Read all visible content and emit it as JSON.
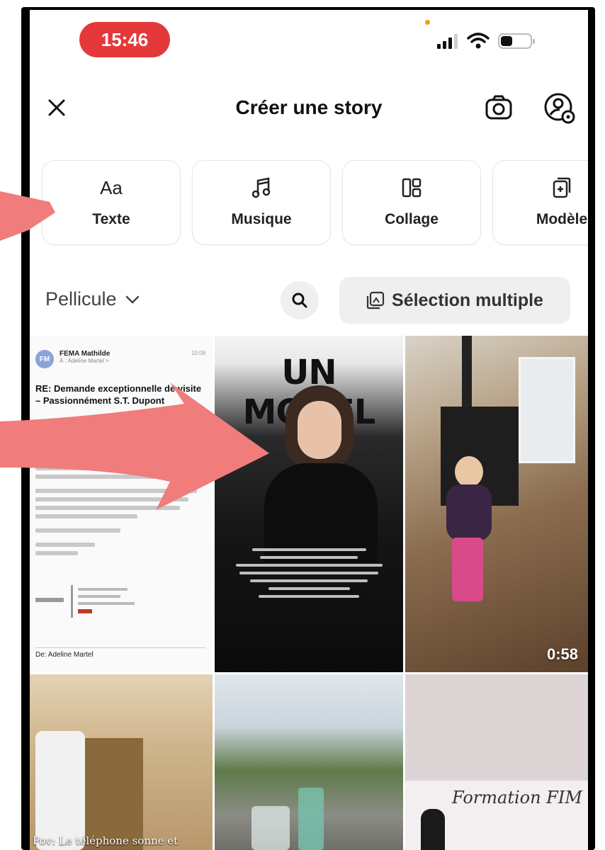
{
  "status": {
    "time": "15:46"
  },
  "header": {
    "title": "Créer une story"
  },
  "options": [
    {
      "label": "Texte",
      "icon": "Aa"
    },
    {
      "label": "Musique"
    },
    {
      "label": "Collage"
    },
    {
      "label": "Modèle"
    }
  ],
  "gallery": {
    "album": "Pellicule",
    "multi_select": "Sélection multiple"
  },
  "tiles": {
    "email": {
      "avatar": "FM",
      "sender": "FEMA Mathilde",
      "to": "À : Adeline Martel >",
      "time": "10:08",
      "subject": "RE: Demande exceptionnelle de visite – Passionnément  S.T. Dupont",
      "from": "De: Adeline Martel"
    },
    "model": {
      "title": "UN MODEL"
    },
    "video": {
      "duration": "0:58"
    },
    "room": {
      "caption": "Pov: Le téléphone sonne et"
    },
    "formation": {
      "title": "Formation FIM"
    }
  },
  "colors": {
    "time_pill": "#e5383b",
    "arrow": "#f07c7c"
  }
}
